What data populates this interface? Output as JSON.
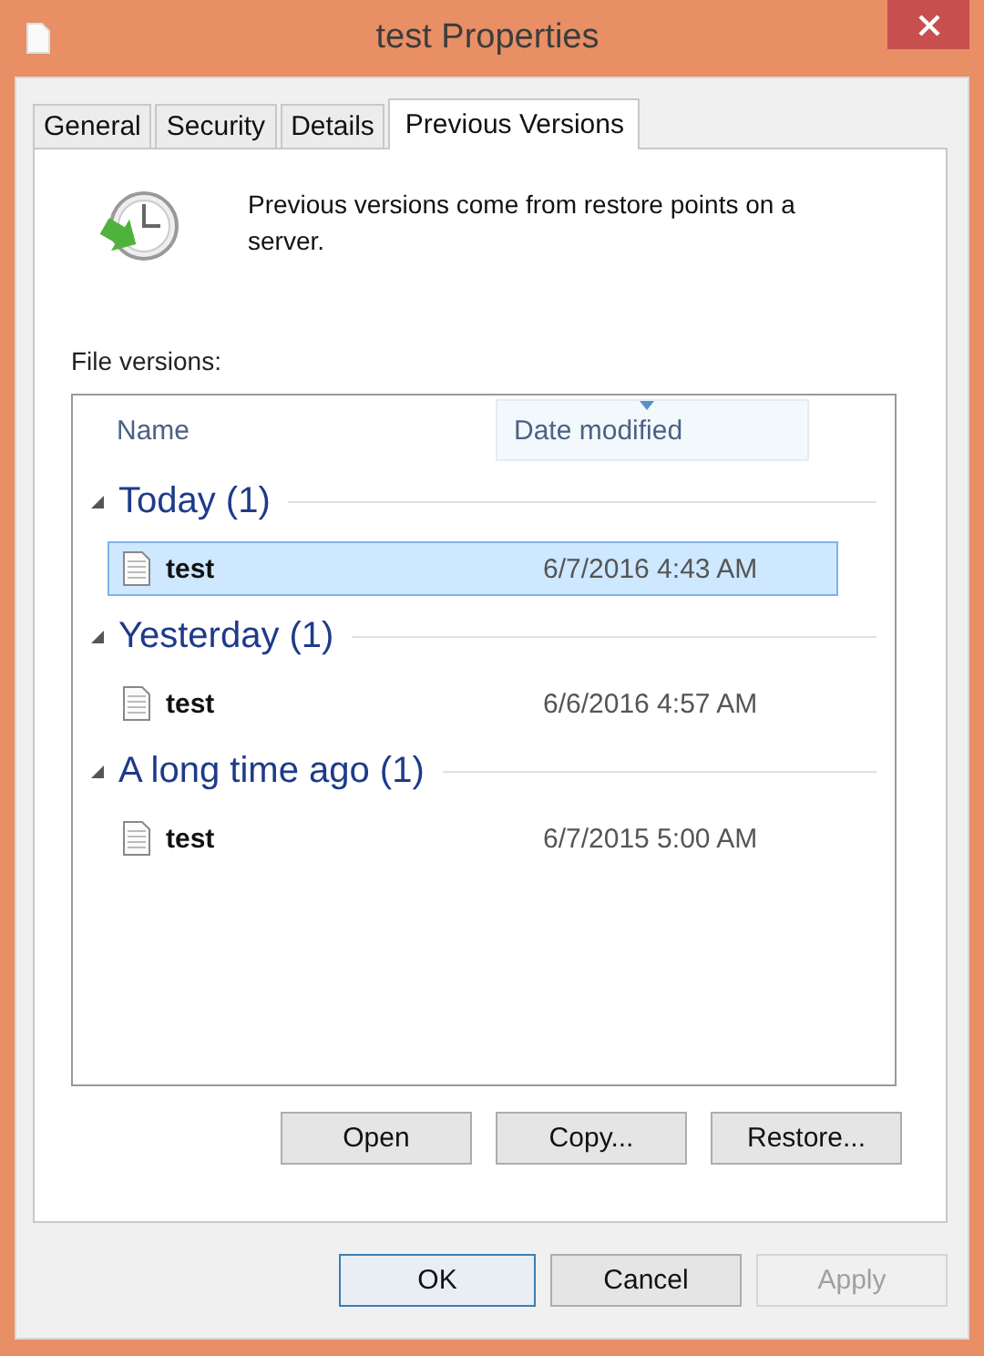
{
  "window": {
    "title": "test Properties"
  },
  "tabs": [
    {
      "label": "General",
      "selected": false
    },
    {
      "label": "Security",
      "selected": false
    },
    {
      "label": "Details",
      "selected": false
    },
    {
      "label": "Previous Versions",
      "selected": true
    }
  ],
  "info": "Previous versions come from restore points on a server.",
  "list_label": "File versions:",
  "columns": [
    {
      "label": "Name",
      "hovered": false
    },
    {
      "label": "Date modified",
      "hovered": true
    }
  ],
  "groups": [
    {
      "title": "Today (1)",
      "expanded": true,
      "rows": [
        {
          "name": "test",
          "date": "6/7/2016 4:43 AM",
          "selected": true
        }
      ]
    },
    {
      "title": "Yesterday (1)",
      "expanded": true,
      "rows": [
        {
          "name": "test",
          "date": "6/6/2016 4:57 AM",
          "selected": false
        }
      ]
    },
    {
      "title": "A long time ago (1)",
      "expanded": true,
      "rows": [
        {
          "name": "test",
          "date": "6/7/2015 5:00 AM",
          "selected": false
        }
      ]
    }
  ],
  "actions": [
    {
      "label": "Open",
      "disabled": false
    },
    {
      "label": "Copy...",
      "disabled": false
    },
    {
      "label": "Restore...",
      "disabled": false
    }
  ],
  "buttons": [
    {
      "label": "OK",
      "default": true,
      "disabled": false
    },
    {
      "label": "Cancel",
      "default": false,
      "disabled": false
    },
    {
      "label": "Apply",
      "default": false,
      "disabled": true
    }
  ]
}
